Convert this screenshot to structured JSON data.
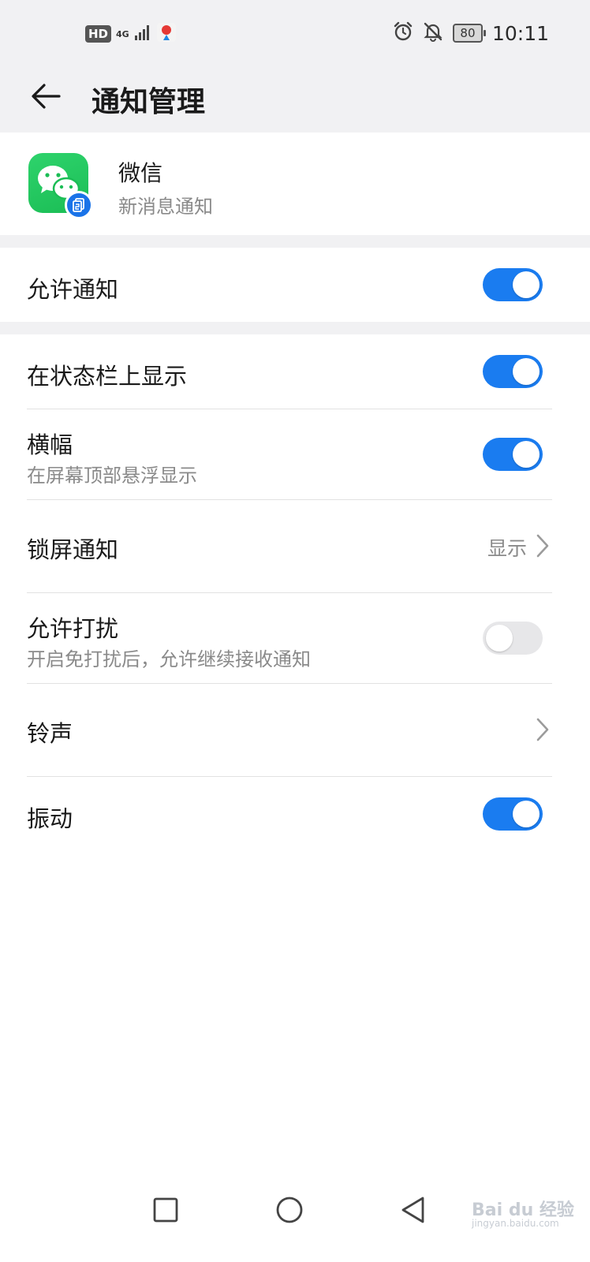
{
  "status_bar": {
    "hd": "HD",
    "network": "4G",
    "battery": "80",
    "time": "10:11",
    "icons": [
      "signal-icon",
      "maps-icon",
      "alarm-icon",
      "bell-off-icon",
      "battery-icon"
    ]
  },
  "title_bar": {
    "title": "通知管理",
    "back_icon": "arrow-left-icon"
  },
  "app": {
    "name": "微信",
    "subtitle": "新消息通知",
    "icon": "wechat-icon",
    "badge_icon": "twin-app-icon"
  },
  "settings": {
    "allow_notifications": {
      "label": "允许通知",
      "enabled": true
    },
    "status_bar_display": {
      "label": "在状态栏上显示",
      "enabled": true
    },
    "banner": {
      "label": "横幅",
      "description": "在屏幕顶部悬浮显示",
      "enabled": true
    },
    "lock_screen": {
      "label": "锁屏通知",
      "value": "显示"
    },
    "allow_dnd": {
      "label": "允许打扰",
      "description": "开启免打扰后，允许继续接收通知",
      "enabled": false
    },
    "ringtone": {
      "label": "铃声"
    },
    "vibrate": {
      "label": "振动",
      "enabled": true
    }
  },
  "nav_bar": {
    "icons": [
      "recents-square-icon",
      "home-circle-icon",
      "back-triangle-icon"
    ]
  },
  "watermark": {
    "text": "Bai du 经验",
    "url": "jingyan.baidu.com"
  },
  "colors": {
    "accent": "#1a7cf0",
    "wechat_green": "#1bbd55",
    "background_gray": "#f1f1f3"
  }
}
